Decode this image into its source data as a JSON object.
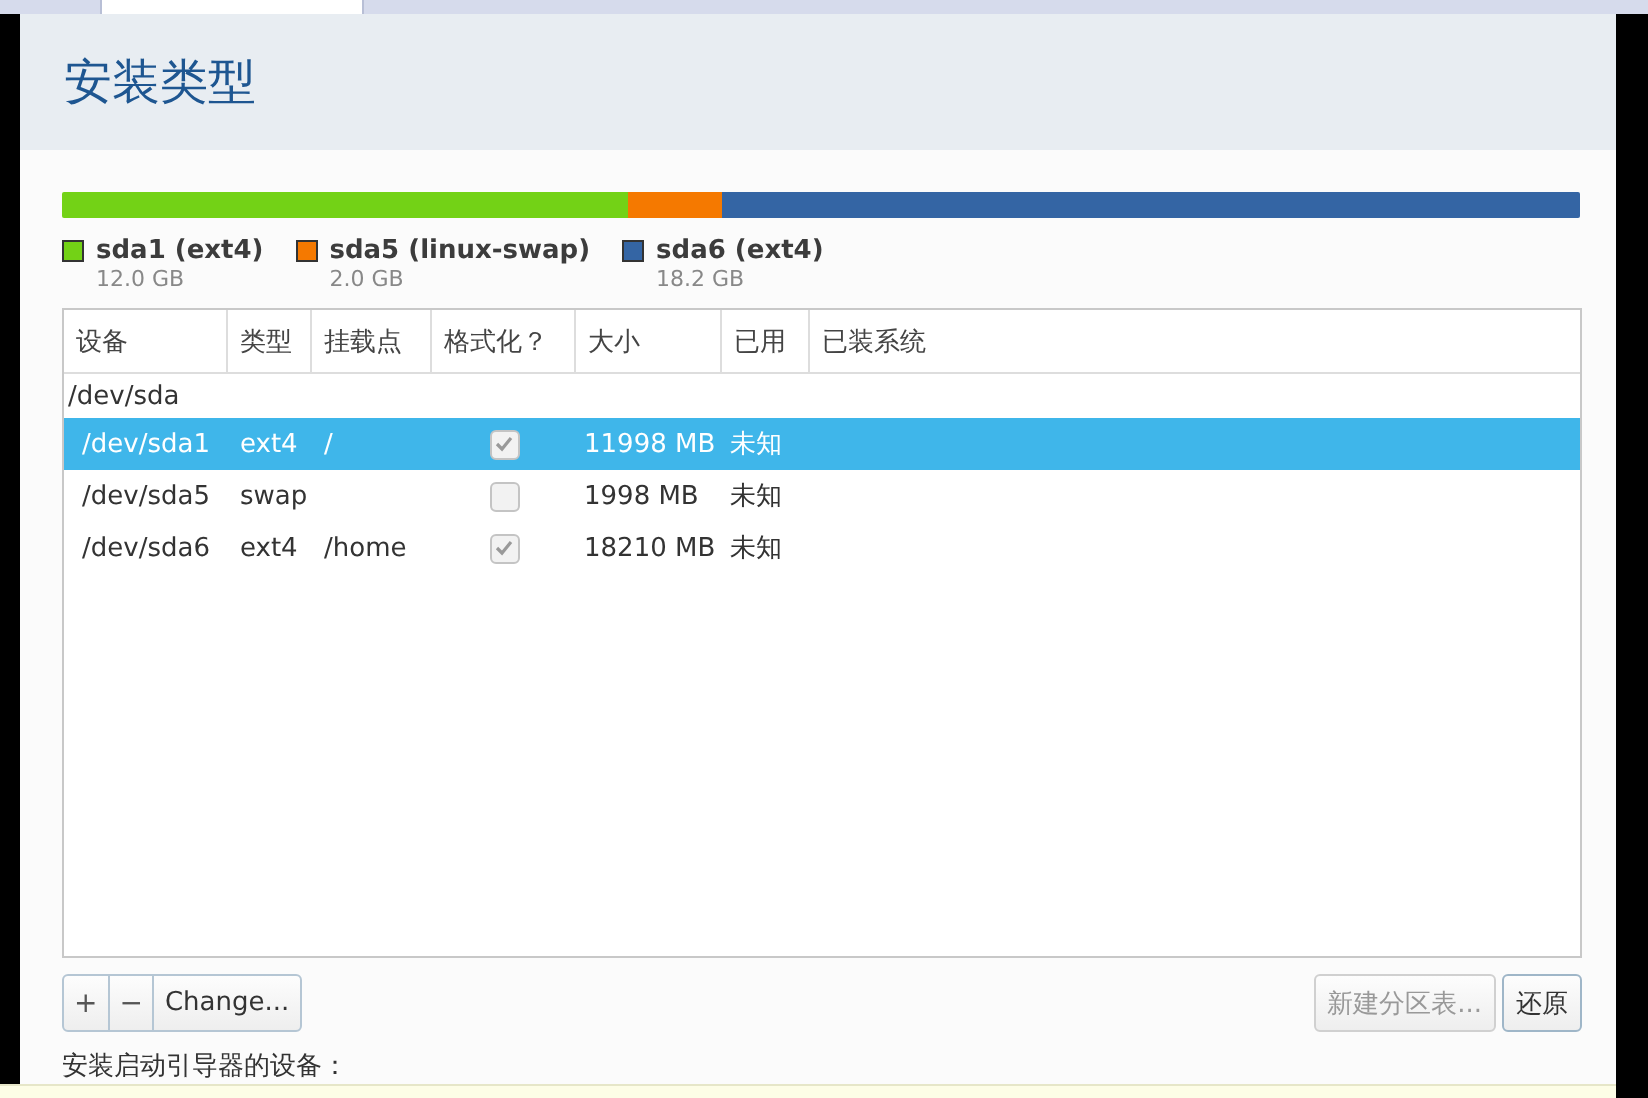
{
  "title": "安装类型",
  "disk_bar": [
    {
      "name": "sda1 (ext4)",
      "size": "12.0 GB",
      "color": "#73d216"
    },
    {
      "name": "sda5 (linux-swap)",
      "size": "2.0 GB",
      "color": "#f57900"
    },
    {
      "name": "sda6 (ext4)",
      "size": "18.2 GB",
      "color": "#3465a4"
    }
  ],
  "table": {
    "columns": [
      "设备",
      "类型",
      "挂载点",
      "格式化？",
      "大小",
      "已用",
      "已装系统"
    ],
    "rows": [
      {
        "device": "/dev/sda",
        "expanded": true,
        "children": [
          {
            "device": "/dev/sda1",
            "type": "ext4",
            "mount": "/",
            "format": true,
            "size": "11998 MB",
            "used": "未知",
            "selected": true
          },
          {
            "device": "/dev/sda5",
            "type": "swap",
            "format": false,
            "size": "1998 MB",
            "used": "未知",
            "selected": false
          },
          {
            "device": "/dev/sda6",
            "type": "ext4",
            "mount": "/home",
            "format": true,
            "size": "18210 MB",
            "used": "未知",
            "selected": false
          }
        ]
      }
    ]
  },
  "toolbar": {
    "add": "+",
    "remove": "−",
    "change": "Change..."
  },
  "buttons": [
    {
      "label": "新建分区表...",
      "disabled": true
    },
    {
      "label": "还原",
      "disabled": false
    }
  ],
  "bootloader_label": "安装启动引导器的设备："
}
